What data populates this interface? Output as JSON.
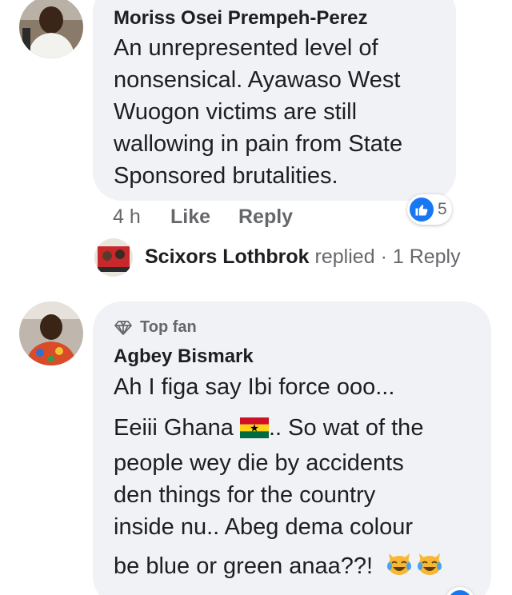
{
  "comments": [
    {
      "author": "Moriss Osei Prempeh-Perez",
      "lines": [
        "An unrepresented level of",
        "nonsensical. Ayawaso West",
        "Wuogon victims are still",
        "wallowing in pain from State",
        "Sponsored brutalities."
      ],
      "time": "4 h",
      "like_label": "Like",
      "reply_label": "Reply",
      "reaction_count": "5",
      "reaction_icon": "thumbs-up-icon"
    },
    {
      "badge": "Top fan",
      "badge_icon": "diamond-icon",
      "author": "Agbey Bismark",
      "lines": [
        "Ah I figa say Ibi force ooo...",
        "Eeiii Ghana",
        ".. So wat of the",
        "people wey die by accidents",
        "den things for the country",
        "inside nu.. Abeg dema colour",
        "be blue or green anaa??!"
      ],
      "inline_emoji": [
        "ghana-flag-icon",
        "laughing-crying-cat-icon",
        "laughing-crying-cat-icon"
      ]
    }
  ],
  "replies_summary": {
    "name": "Scixors Lothbrok",
    "verb": "replied",
    "separator": "·",
    "link": "1 Reply"
  },
  "colors": {
    "bubble_bg": "#f0f2f5",
    "meta_text": "#65676b",
    "brand_blue": "#1877f2"
  }
}
